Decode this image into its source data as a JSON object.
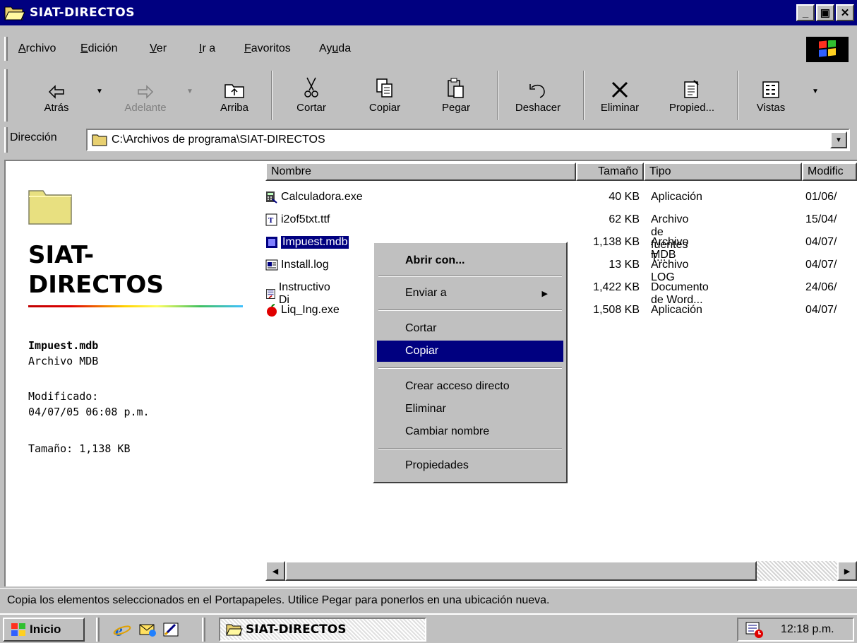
{
  "window": {
    "title": "SIAT-DIRECTOS",
    "icon": "folder-open-icon",
    "buttons": [
      "minimize-icon",
      "maximize-icon",
      "close-icon"
    ]
  },
  "menubar": {
    "items": [
      {
        "label": "Archivo",
        "u": 0
      },
      {
        "label": "Edición",
        "u": 0
      },
      {
        "label": "Ver",
        "u": 0
      },
      {
        "label": "Ir a",
        "u": 0
      },
      {
        "label": "Favoritos",
        "u": 0
      },
      {
        "label": "Ayuda",
        "u": 2
      }
    ]
  },
  "toolbar": {
    "back": "Atrás",
    "forward": "Adelante",
    "up": "Arriba",
    "cut": "Cortar",
    "copy": "Copiar",
    "paste": "Pegar",
    "undo": "Deshacer",
    "delete": "Eliminar",
    "properties": "Propied...",
    "views": "Vistas"
  },
  "address": {
    "label": "Dirección",
    "value": "C:\\Archivos de programa\\SIAT-DIRECTOS"
  },
  "info_panel": {
    "folder_title_1": "SIAT-",
    "folder_title_2": "DIRECTOS",
    "selected_name": "Impuest.mdb",
    "selected_type": "Archivo MDB",
    "modified_label": "Modificado:",
    "modified_value": "04/07/05 06:08 p.m.",
    "size": "Tamaño: 1,138 KB"
  },
  "columns": {
    "name": "Nombre",
    "size": "Tamaño",
    "type": "Tipo",
    "modified": "Modific"
  },
  "files": [
    {
      "name": "Calculadora.exe",
      "size": "40 KB",
      "type": "Aplicación",
      "modified": "01/06/",
      "icon": "calculator-app-icon"
    },
    {
      "name": "i2of5txt.ttf",
      "size": "62 KB",
      "type": "Archivo de fuentes T...",
      "modified": "15/04/",
      "icon": "truetype-font-icon"
    },
    {
      "name": "Impuest.mdb",
      "size": "1,138 KB",
      "type": "Archivo MDB",
      "modified": "04/07/",
      "icon": "database-file-icon"
    },
    {
      "name": "Install.log",
      "size": "13 KB",
      "type": "Archivo LOG",
      "modified": "04/07/",
      "icon": "log-file-icon"
    },
    {
      "name": "Instructivo Di",
      "size": "1,422 KB",
      "type": "Documento de Word...",
      "modified": "24/06/",
      "icon": "word-document-icon"
    },
    {
      "name": "Liq_Ing.exe",
      "size": "1,508 KB",
      "type": "Aplicación",
      "modified": "04/07/",
      "icon": "apple-app-icon"
    }
  ],
  "context_menu": {
    "open_with": "Abrir con...",
    "send_to": "Enviar a",
    "cut": "Cortar",
    "copy": "Copiar",
    "create_shortcut": "Crear acceso directo",
    "delete": "Eliminar",
    "rename": "Cambiar nombre",
    "properties": "Propiedades"
  },
  "statusbar": {
    "text": "Copia los elementos seleccionados en el Portapapeles. Utilice Pegar para ponerlos en una ubicación nueva."
  },
  "taskbar": {
    "start": "Inicio",
    "task": "SIAT-DIRECTOS",
    "clock": "12:18 p.m."
  },
  "colors": {
    "titlebar": "#000080",
    "selection": "#000080",
    "face": "#c0c0c0"
  }
}
